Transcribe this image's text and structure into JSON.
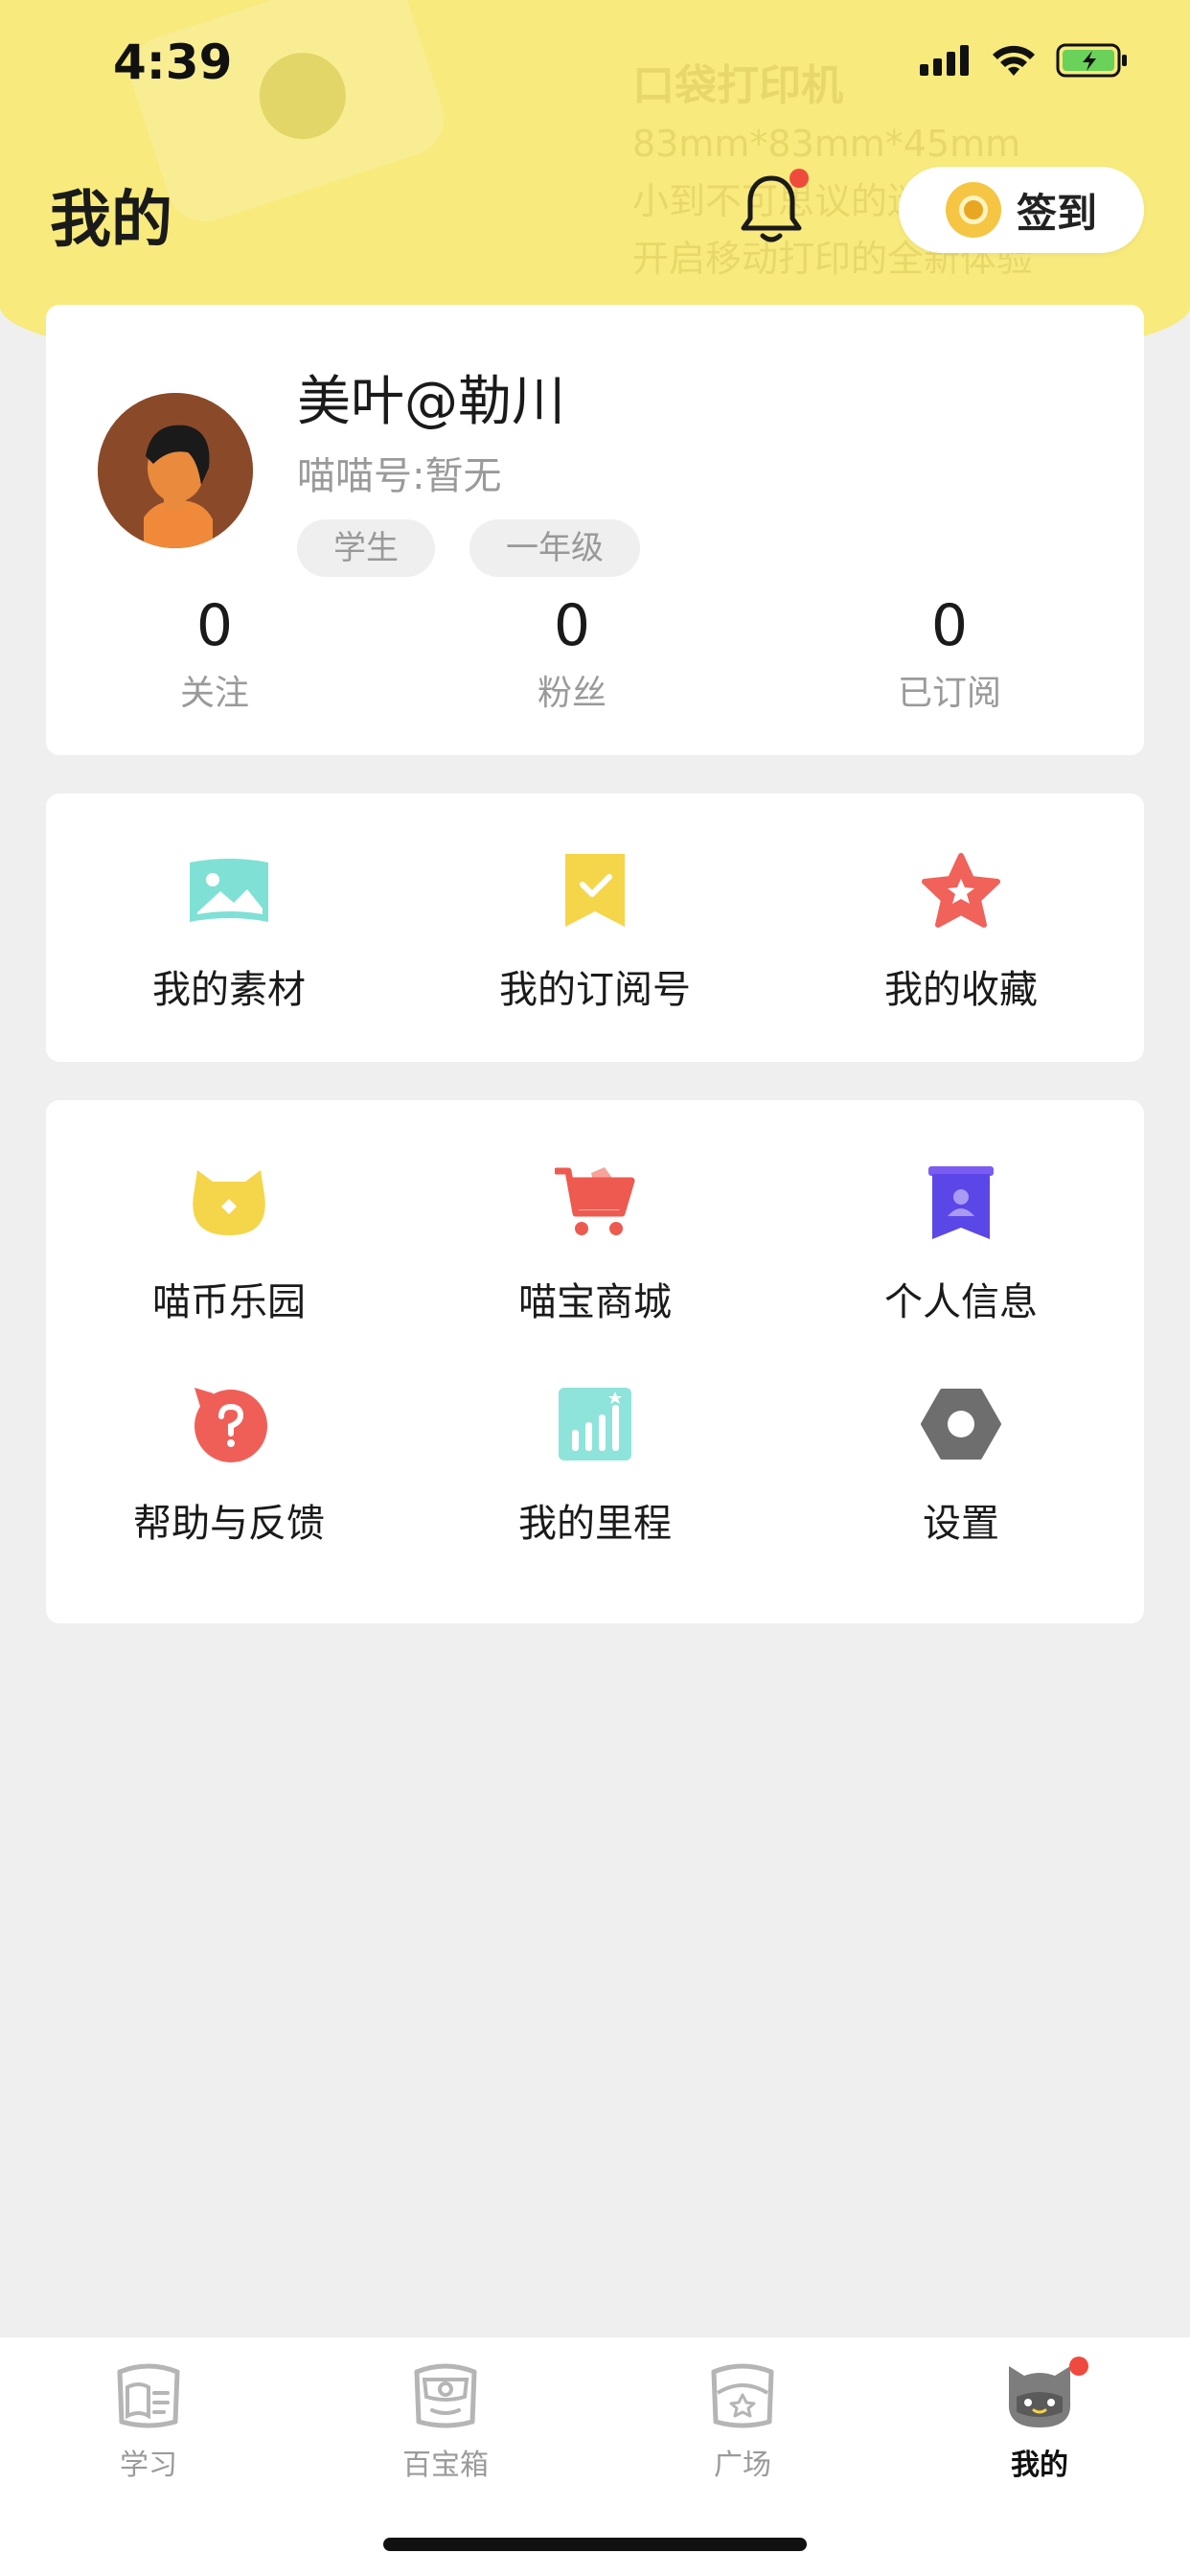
{
  "status_bar": {
    "time": "4:39"
  },
  "header": {
    "title": "我的",
    "signin_label": "签到",
    "deco_lines": [
      "口袋打印机",
      "83mm*83mm*45mm",
      "小到不可思议的迷你",
      "开启移动打印的全新体验"
    ]
  },
  "profile": {
    "name": "美叶@勒川",
    "miao_id": "喵喵号:暂无",
    "tags": [
      "学生",
      "一年级"
    ],
    "stats": [
      {
        "value": "0",
        "label": "关注"
      },
      {
        "value": "0",
        "label": "粉丝"
      },
      {
        "value": "0",
        "label": "已订阅"
      }
    ]
  },
  "menu1": [
    {
      "label": "我的素材",
      "icon": "image-icon"
    },
    {
      "label": "我的订阅号",
      "icon": "bookmark-icon"
    },
    {
      "label": "我的收藏",
      "icon": "star-icon"
    }
  ],
  "menu2": [
    {
      "label": "喵币乐园",
      "icon": "coin-cat-icon"
    },
    {
      "label": "喵宝商城",
      "icon": "cart-icon"
    },
    {
      "label": "个人信息",
      "icon": "id-badge-icon"
    },
    {
      "label": "帮助与反馈",
      "icon": "help-icon"
    },
    {
      "label": "我的里程",
      "icon": "chart-icon"
    },
    {
      "label": "设置",
      "icon": "settings-icon"
    }
  ],
  "tabbar": [
    {
      "label": "学习",
      "icon": "study-icon",
      "active": false
    },
    {
      "label": "百宝箱",
      "icon": "toolbox-icon",
      "active": false
    },
    {
      "label": "广场",
      "icon": "plaza-icon",
      "active": false
    },
    {
      "label": "我的",
      "icon": "cat-avatar-icon",
      "active": true
    }
  ],
  "colors": {
    "header_yellow": "#f8ea7c",
    "accent_red": "#f04a3e",
    "background": "#efefef"
  }
}
